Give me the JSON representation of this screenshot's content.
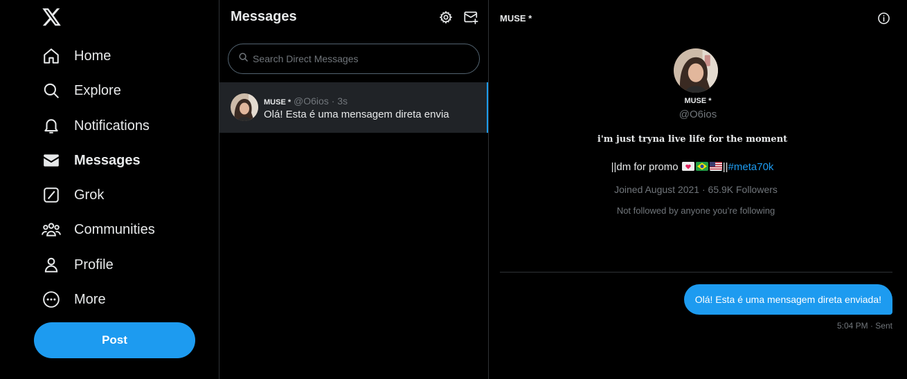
{
  "nav": {
    "logo": "x-logo-icon",
    "items": [
      {
        "label": "Home",
        "icon": "home-icon"
      },
      {
        "label": "Explore",
        "icon": "search-icon"
      },
      {
        "label": "Notifications",
        "icon": "bell-icon"
      },
      {
        "label": "Messages",
        "icon": "envelope-icon",
        "active": true
      },
      {
        "label": "Grok",
        "icon": "grok-icon"
      },
      {
        "label": "Communities",
        "icon": "communities-icon"
      },
      {
        "label": "Profile",
        "icon": "person-icon"
      },
      {
        "label": "More",
        "icon": "more-circle-icon"
      }
    ],
    "post_label": "Post"
  },
  "messages": {
    "title": "Messages",
    "settings_icon": "gear-icon",
    "new_message_icon": "compose-message-icon",
    "search_placeholder": "Search Direct Messages",
    "conversations": [
      {
        "name": "MUSE *",
        "handle": "@O6ios",
        "time": "· 3s",
        "preview": "Olá! Esta é uma mensagem direta envia"
      }
    ]
  },
  "conversation": {
    "title": "MUSE *",
    "info_icon": "info-icon",
    "profile": {
      "name": "MUSE *",
      "handle": "@O6ios",
      "bio_line1": "𝐢'𝐦 𝐣𝐮𝐬𝐭 𝐭𝐫𝐲𝐧𝐚 𝐥𝐢𝐯𝐞 𝐥𝐢𝐟𝐞 𝐟𝐨𝐫 𝐭𝐡𝐞 𝐦𝐨𝐦𝐞𝐧𝐭",
      "bio_line2_prefix": "||dm for promo ",
      "bio_line2_sep": "||",
      "bio_hashtag": "#meta70k",
      "joined": "Joined August 2021 · 65.9K Followers",
      "followed_by": "Not followed by anyone you’re following"
    },
    "messages": [
      {
        "text": "Olá! Esta é uma mensagem direta enviada!",
        "meta": "5:04 PM · Sent"
      }
    ]
  },
  "colors": {
    "accent": "#1d9bf0",
    "background": "#000000",
    "border": "#2f3336",
    "muted": "#71767b",
    "selected": "#202327"
  }
}
